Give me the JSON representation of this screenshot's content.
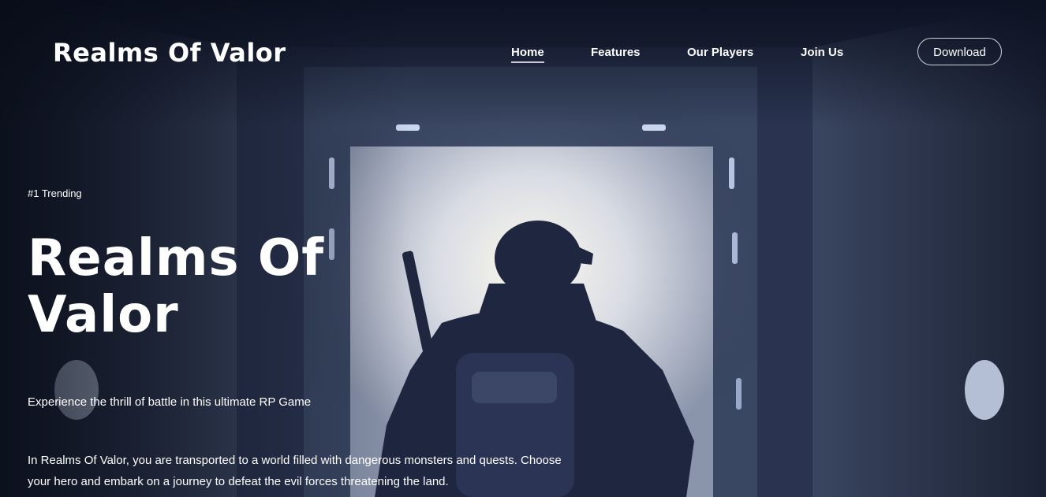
{
  "header": {
    "logo": "Realms Of Valor",
    "nav": [
      {
        "label": "Home",
        "active": true
      },
      {
        "label": "Features",
        "active": false
      },
      {
        "label": "Our Players",
        "active": false
      },
      {
        "label": "Join Us",
        "active": false
      }
    ],
    "download_label": "Download"
  },
  "hero": {
    "badge": "#1 Trending",
    "title": "Realms Of Valor",
    "tagline": "Experience the thrill of battle in this ultimate RP Game",
    "description": "In Realms Of Valor, you are transported to a world filled with dangerous monsters and quests. Choose your hero and embark on a journey to defeat the evil forces threatening the land."
  },
  "colors": {
    "background": "#0d1322",
    "doorway_glow": "#f4f1e6",
    "text": "#ffffff",
    "button_border": "#cfd2da"
  },
  "icons": {
    "hero_image": "soldier-in-doorway-illustration"
  }
}
